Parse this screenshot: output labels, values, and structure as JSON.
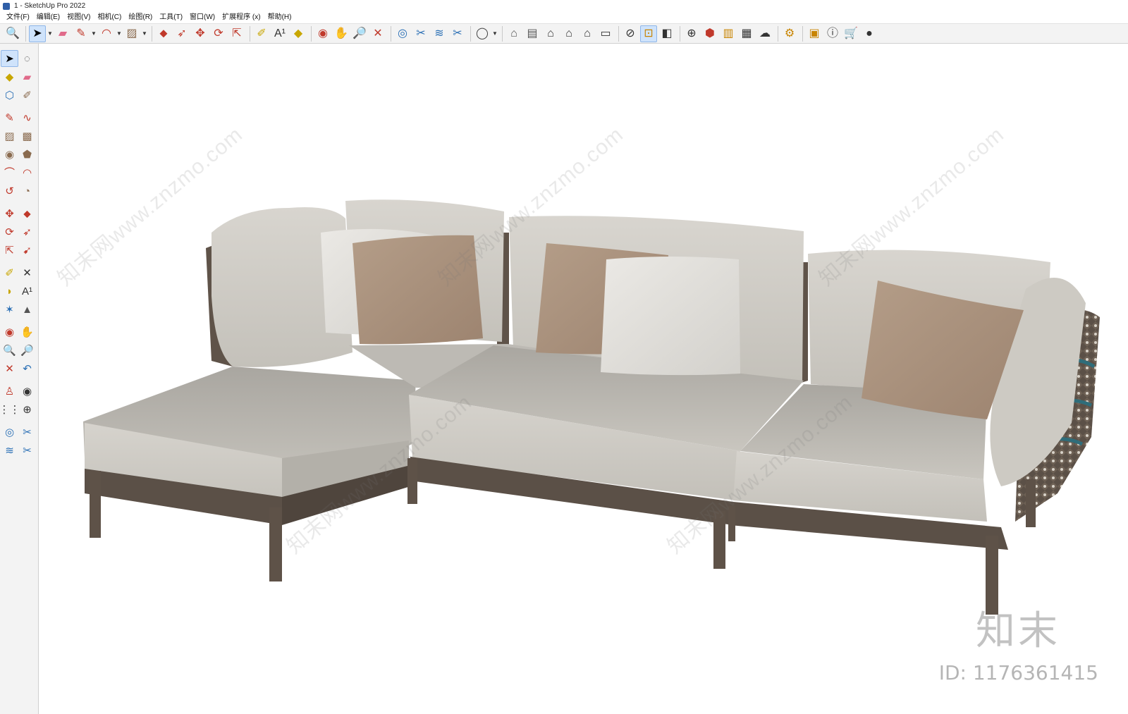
{
  "window": {
    "title": "1 - SketchUp Pro 2022"
  },
  "menu": [
    "文件(F)",
    "编辑(E)",
    "视图(V)",
    "相机(C)",
    "绘图(R)",
    "工具(T)",
    "窗口(W)",
    "扩展程序 (x)",
    "帮助(H)"
  ],
  "toolbar": {
    "groups": [
      [
        {
          "name": "zoom-icon",
          "glyph": "🔍"
        }
      ],
      [
        {
          "name": "select-icon",
          "glyph": "➤",
          "active": true,
          "caret": true
        },
        {
          "name": "eraser-icon",
          "glyph": "▰",
          "color": "#e06a8a"
        },
        {
          "name": "pencil-icon",
          "glyph": "✎",
          "color": "#c0392b",
          "caret": true
        },
        {
          "name": "arc-icon",
          "glyph": "◠",
          "color": "#c0392b",
          "caret": true
        },
        {
          "name": "rectangle-icon",
          "glyph": "▨",
          "color": "#8a6b4f",
          "caret": true
        }
      ],
      [
        {
          "name": "push-pull-icon",
          "glyph": "⬥",
          "color": "#c0392b"
        },
        {
          "name": "follow-me-icon",
          "glyph": "➶",
          "color": "#c0392b"
        },
        {
          "name": "move-icon",
          "glyph": "✥",
          "color": "#c0392b"
        },
        {
          "name": "rotate-icon",
          "glyph": "⟳",
          "color": "#c0392b"
        },
        {
          "name": "scale-icon",
          "glyph": "⇱",
          "color": "#c0392b"
        }
      ],
      [
        {
          "name": "tape-measure-icon",
          "glyph": "✐",
          "color": "#c8a600"
        },
        {
          "name": "text-icon",
          "glyph": "A¹",
          "color": "#333"
        },
        {
          "name": "paint-bucket-icon",
          "glyph": "◆",
          "color": "#c8a600"
        }
      ],
      [
        {
          "name": "orbit-icon",
          "glyph": "◉",
          "color": "#c0392b"
        },
        {
          "name": "pan-icon",
          "glyph": "✋",
          "color": "#d7a86e"
        },
        {
          "name": "zoom-tool-icon",
          "glyph": "🔎"
        },
        {
          "name": "zoom-extents-icon",
          "glyph": "✕",
          "color": "#c0392b"
        }
      ],
      [
        {
          "name": "warehouse-icon",
          "glyph": "◎",
          "color": "#2a6fb5"
        },
        {
          "name": "extension-warehouse-icon",
          "glyph": "✂",
          "color": "#2a6fb5"
        },
        {
          "name": "layer-icon",
          "glyph": "≋",
          "color": "#2a6fb5"
        },
        {
          "name": "extension-manager-icon",
          "glyph": "✂",
          "color": "#2a6fb5"
        }
      ],
      [
        {
          "name": "user-profile-icon",
          "glyph": "◯",
          "color": "#444",
          "caret": true
        }
      ],
      [
        {
          "name": "iso-view-icon",
          "glyph": "⌂",
          "color": "#555"
        },
        {
          "name": "top-view-icon",
          "glyph": "▤",
          "color": "#555"
        },
        {
          "name": "front-view-icon",
          "glyph": "⌂",
          "color": "#333"
        },
        {
          "name": "right-view-icon",
          "glyph": "⌂",
          "color": "#333"
        },
        {
          "name": "back-view-icon",
          "glyph": "⌂",
          "color": "#333"
        },
        {
          "name": "left-view-icon",
          "glyph": "▭",
          "color": "#333"
        }
      ],
      [
        {
          "name": "section-plane-icon",
          "glyph": "⊘",
          "color": "#333"
        },
        {
          "name": "section-display-icon",
          "glyph": "⊡",
          "color": "#c88400",
          "active": true
        },
        {
          "name": "section-fill-icon",
          "glyph": "◧",
          "color": "#333"
        }
      ],
      [
        {
          "name": "add-location-icon",
          "glyph": "⊕",
          "color": "#333"
        },
        {
          "name": "shadow-icon",
          "glyph": "⬢",
          "color": "#c0392b"
        },
        {
          "name": "preview-icon",
          "glyph": "▥",
          "color": "#c88400"
        },
        {
          "name": "styles-icon",
          "glyph": "▦",
          "color": "#333"
        },
        {
          "name": "cloud-icon",
          "glyph": "☁",
          "color": "#333"
        }
      ],
      [
        {
          "name": "settings-icon",
          "glyph": "⚙",
          "color": "#c88400"
        }
      ],
      [
        {
          "name": "scenes-icon",
          "glyph": "▣",
          "color": "#c88400"
        },
        {
          "name": "info-icon",
          "glyph": "ⓘ",
          "color": "#333"
        },
        {
          "name": "cart-icon",
          "glyph": "🛒",
          "color": "#333"
        },
        {
          "name": "account-icon",
          "glyph": "●",
          "color": "#333"
        }
      ]
    ]
  },
  "lefttoolbar": {
    "rows": [
      [
        {
          "name": "select-icon",
          "glyph": "➤",
          "active": true
        },
        {
          "name": "lasso-select-icon",
          "glyph": "◌",
          "color": "#333"
        }
      ],
      [
        {
          "name": "paint-bucket-icon",
          "glyph": "◆",
          "color": "#c8a600"
        },
        {
          "name": "eraser-icon",
          "glyph": "▰",
          "color": "#e06a8a"
        }
      ],
      [
        {
          "name": "component-icon",
          "glyph": "⬡",
          "color": "#2a6fb5"
        },
        {
          "name": "tag-icon",
          "glyph": "✐",
          "color": "#8a6b4f"
        }
      ],
      "sep",
      [
        {
          "name": "pencil-icon",
          "glyph": "✎",
          "color": "#c0392b"
        },
        {
          "name": "freehand-icon",
          "glyph": "∿",
          "color": "#c0392b"
        }
      ],
      [
        {
          "name": "rectangle-icon",
          "glyph": "▨",
          "color": "#8a6b4f"
        },
        {
          "name": "rotated-rectangle-icon",
          "glyph": "▩",
          "color": "#8a6b4f"
        }
      ],
      [
        {
          "name": "circle-icon",
          "glyph": "◉",
          "color": "#8a6b4f"
        },
        {
          "name": "polygon-icon",
          "glyph": "⬟",
          "color": "#8a6b4f"
        }
      ],
      [
        {
          "name": "arc-icon",
          "glyph": "⌒",
          "color": "#c0392b"
        },
        {
          "name": "two-point-arc-icon",
          "glyph": "◠",
          "color": "#c0392b"
        }
      ],
      [
        {
          "name": "three-point-arc-icon",
          "glyph": "↺",
          "color": "#c0392b"
        },
        {
          "name": "pie-icon",
          "glyph": "◔",
          "color": "#8a6b4f"
        }
      ],
      "sep",
      [
        {
          "name": "move-icon",
          "glyph": "✥",
          "color": "#c0392b"
        },
        {
          "name": "push-pull-icon",
          "glyph": "⬥",
          "color": "#c0392b"
        }
      ],
      [
        {
          "name": "rotate-icon",
          "glyph": "⟳",
          "color": "#c0392b"
        },
        {
          "name": "follow-me-icon",
          "glyph": "➶",
          "color": "#c0392b"
        }
      ],
      [
        {
          "name": "scale-icon",
          "glyph": "⇱",
          "color": "#c0392b"
        },
        {
          "name": "offset-icon",
          "glyph": "➹",
          "color": "#c0392b"
        }
      ],
      "sep",
      [
        {
          "name": "tape-measure-icon",
          "glyph": "✐",
          "color": "#c8a600"
        },
        {
          "name": "dimension-icon",
          "glyph": "✕",
          "color": "#333"
        }
      ],
      [
        {
          "name": "protractor-icon",
          "glyph": "◗",
          "color": "#c8a600"
        },
        {
          "name": "text-icon",
          "glyph": "A¹",
          "color": "#333"
        }
      ],
      [
        {
          "name": "axes-icon",
          "glyph": "✶",
          "color": "#2a6fb5"
        },
        {
          "name": "3d-text-icon",
          "glyph": "▲",
          "color": "#555"
        }
      ],
      "sep",
      [
        {
          "name": "orbit-icon",
          "glyph": "◉",
          "color": "#c0392b"
        },
        {
          "name": "pan-icon",
          "glyph": "✋",
          "color": "#d7a86e"
        }
      ],
      [
        {
          "name": "zoom-icon",
          "glyph": "🔍"
        },
        {
          "name": "zoom-window-icon",
          "glyph": "🔎"
        }
      ],
      [
        {
          "name": "zoom-extents-icon",
          "glyph": "✕",
          "color": "#c0392b"
        },
        {
          "name": "previous-view-icon",
          "glyph": "↶",
          "color": "#2a6fb5"
        }
      ],
      "sep",
      [
        {
          "name": "position-camera-icon",
          "glyph": "♙",
          "color": "#c0392b"
        },
        {
          "name": "look-around-icon",
          "glyph": "◉",
          "color": "#333"
        }
      ],
      [
        {
          "name": "walk-icon",
          "glyph": "⋮⋮",
          "color": "#333"
        },
        {
          "name": "section-plane-icon",
          "glyph": "⊕",
          "color": "#333"
        }
      ],
      "sep",
      [
        {
          "name": "warehouse-icon",
          "glyph": "◎",
          "color": "#2a6fb5"
        },
        {
          "name": "extension-warehouse-icon",
          "glyph": "✂",
          "color": "#2a6fb5"
        }
      ],
      [
        {
          "name": "layer-icon",
          "glyph": "≋",
          "color": "#2a6fb5"
        },
        {
          "name": "extension-manager-icon",
          "glyph": "✂",
          "color": "#2a6fb5"
        }
      ]
    ]
  },
  "watermark": {
    "site": "知末网www.znzmo.com",
    "logo": "知末",
    "id_text": "ID: 1176361415"
  }
}
